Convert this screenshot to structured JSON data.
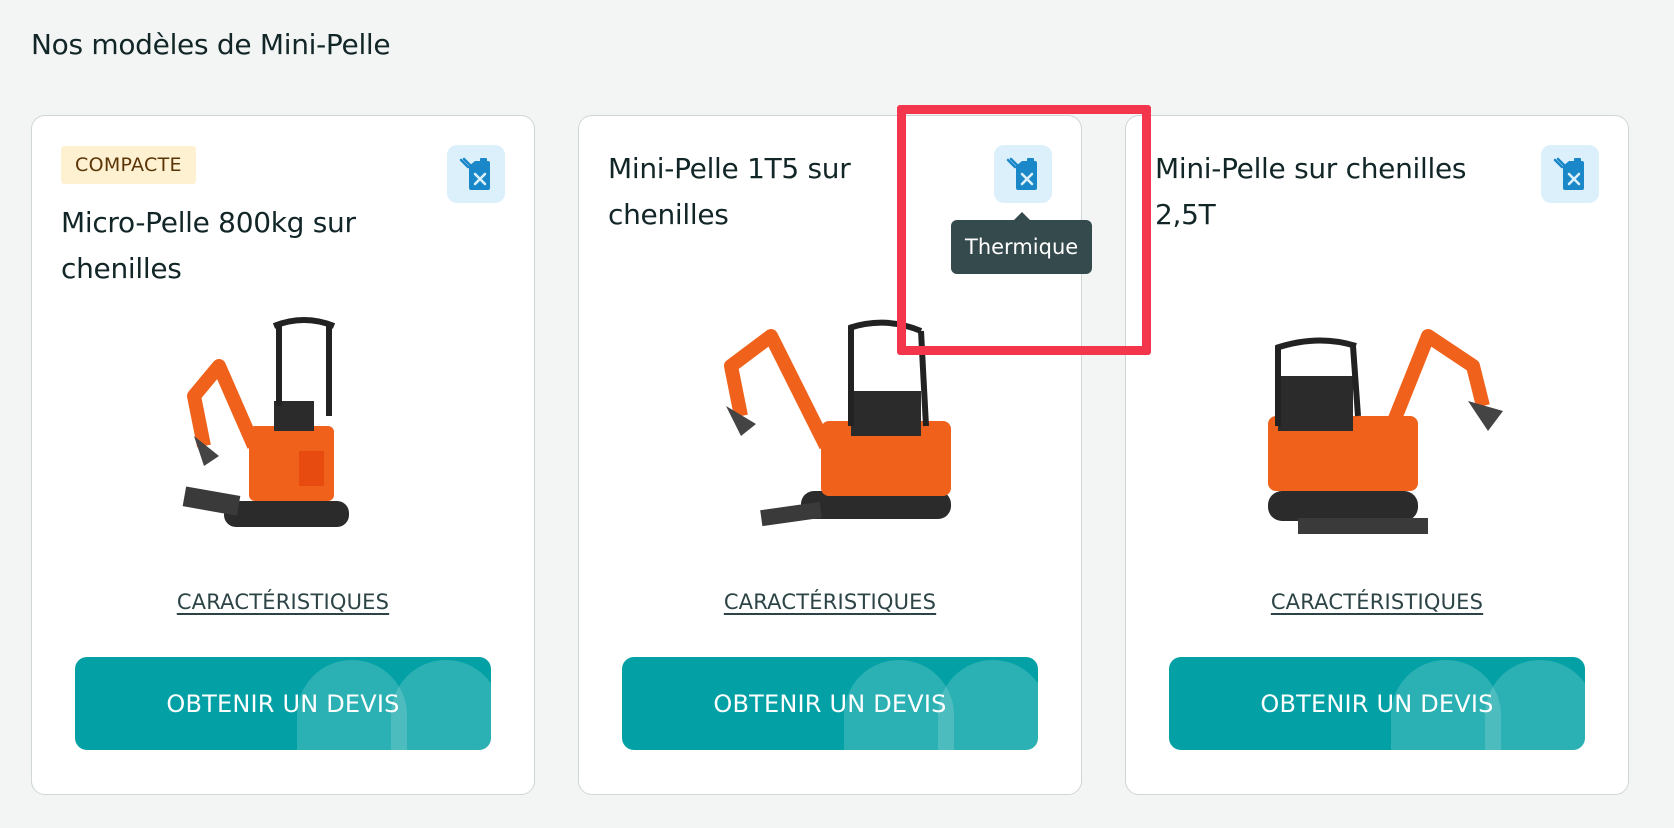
{
  "section": {
    "title": "Nos modèles de Mini-Pelle"
  },
  "cards": [
    {
      "badge": "COMPACTE",
      "title": "Micro-Pelle 800kg sur chenilles",
      "fuel_icon": "fuel-jerrycan-icon",
      "specs_label": "CARACTÉRISTIQUES",
      "cta_label": "OBTENIR UN DEVIS"
    },
    {
      "title": "Mini-Pelle 1T5 sur chenilles",
      "fuel_icon": "fuel-jerrycan-icon",
      "specs_label": "CARACTÉRISTIQUES",
      "cta_label": "OBTENIR UN DEVIS"
    },
    {
      "title": "Mini-Pelle sur chenilles 2,5T",
      "fuel_icon": "fuel-jerrycan-icon",
      "specs_label": "CARACTÉRISTIQUES",
      "cta_label": "OBTENIR UN DEVIS"
    }
  ],
  "tooltip": {
    "text": "Thermique"
  },
  "colors": {
    "accent": "#03a1a5",
    "badge_bg": "#fdf1d1",
    "icon_bg": "#dcf0fb",
    "icon": "#1a87c9",
    "tooltip_bg": "#354a4c",
    "highlight": "#f4364c",
    "machine_orange": "#f0621b"
  }
}
